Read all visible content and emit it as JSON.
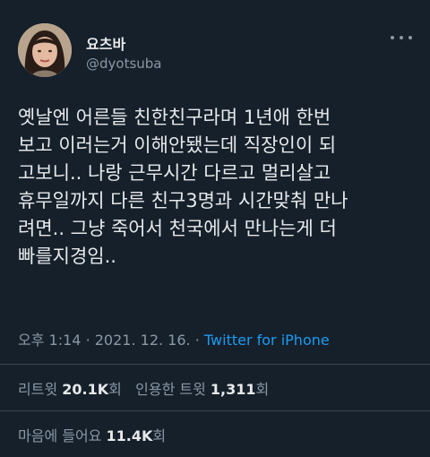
{
  "user": {
    "display_name": "요츠바",
    "handle": "@dyotsuba"
  },
  "tweet": {
    "text": "옛날엔 어른들 친한친구라며 1년애 한번\n보고 이러는거 이해안됐는데 직장인이 되\n고보니.. 나랑 근무시간 다르고 멀리살고\n휴무일까지 다른 친구3명과 시간맞춰 만나\n려면.. 그냥 죽어서 천국에서 만나는게 더\n빠를지경임..",
    "time": "오후 1:14",
    "separator1": "·",
    "date": "2021. 12. 16.",
    "separator2": "·",
    "client": "Twitter for iPhone"
  },
  "stats": {
    "retweet_label": "리트윗",
    "retweet_count": "20.1K",
    "retweet_unit": "회",
    "quote_label": "인용한 트윗",
    "quote_count": "1,311",
    "quote_unit": "회",
    "like_label": "마음에 들어요",
    "like_count": "11.4K",
    "like_unit": "회"
  },
  "colors": {
    "background": "#15202b",
    "text": "#e7e9ea",
    "muted": "#8b98a5",
    "link": "#1d9bf0",
    "divider": "#38444d"
  },
  "icons": {
    "more": "more-horizontal-icon"
  }
}
